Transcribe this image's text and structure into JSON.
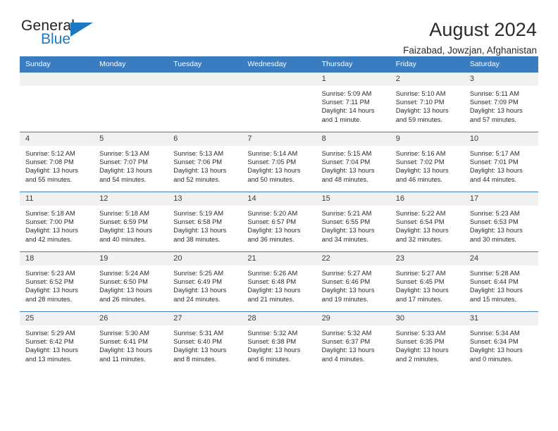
{
  "brand": {
    "name_part1": "General",
    "name_part2": "Blue",
    "triangle_color": "#1d78c1",
    "blue_text_color": "#1d78c1"
  },
  "header": {
    "title": "August 2024",
    "subtitle": "Faizabad, Jowzjan, Afghanistan"
  },
  "theme": {
    "header_row_bg": "#3a7cc0",
    "day_band_bg": "#f1f1f1",
    "grid_line": "#3a7cc0",
    "text": "#2b2b2b"
  },
  "weekday_headers": [
    "Sunday",
    "Monday",
    "Tuesday",
    "Wednesday",
    "Thursday",
    "Friday",
    "Saturday"
  ],
  "labels": {
    "sunrise_prefix": "Sunrise:",
    "sunset_prefix": "Sunset:",
    "daylight_prefix": "Daylight:"
  },
  "weeks": [
    [
      {
        "day": "",
        "empty": true
      },
      {
        "day": "",
        "empty": true
      },
      {
        "day": "",
        "empty": true
      },
      {
        "day": "",
        "empty": true
      },
      {
        "day": "1",
        "sunrise": "Sunrise: 5:09 AM",
        "sunset": "Sunset: 7:11 PM",
        "daylight_line1": "Daylight: 14 hours",
        "daylight_line2": "and 1 minute."
      },
      {
        "day": "2",
        "sunrise": "Sunrise: 5:10 AM",
        "sunset": "Sunset: 7:10 PM",
        "daylight_line1": "Daylight: 13 hours",
        "daylight_line2": "and 59 minutes."
      },
      {
        "day": "3",
        "sunrise": "Sunrise: 5:11 AM",
        "sunset": "Sunset: 7:09 PM",
        "daylight_line1": "Daylight: 13 hours",
        "daylight_line2": "and 57 minutes."
      }
    ],
    [
      {
        "day": "4",
        "sunrise": "Sunrise: 5:12 AM",
        "sunset": "Sunset: 7:08 PM",
        "daylight_line1": "Daylight: 13 hours",
        "daylight_line2": "and 55 minutes."
      },
      {
        "day": "5",
        "sunrise": "Sunrise: 5:13 AM",
        "sunset": "Sunset: 7:07 PM",
        "daylight_line1": "Daylight: 13 hours",
        "daylight_line2": "and 54 minutes."
      },
      {
        "day": "6",
        "sunrise": "Sunrise: 5:13 AM",
        "sunset": "Sunset: 7:06 PM",
        "daylight_line1": "Daylight: 13 hours",
        "daylight_line2": "and 52 minutes."
      },
      {
        "day": "7",
        "sunrise": "Sunrise: 5:14 AM",
        "sunset": "Sunset: 7:05 PM",
        "daylight_line1": "Daylight: 13 hours",
        "daylight_line2": "and 50 minutes."
      },
      {
        "day": "8",
        "sunrise": "Sunrise: 5:15 AM",
        "sunset": "Sunset: 7:04 PM",
        "daylight_line1": "Daylight: 13 hours",
        "daylight_line2": "and 48 minutes."
      },
      {
        "day": "9",
        "sunrise": "Sunrise: 5:16 AM",
        "sunset": "Sunset: 7:02 PM",
        "daylight_line1": "Daylight: 13 hours",
        "daylight_line2": "and 46 minutes."
      },
      {
        "day": "10",
        "sunrise": "Sunrise: 5:17 AM",
        "sunset": "Sunset: 7:01 PM",
        "daylight_line1": "Daylight: 13 hours",
        "daylight_line2": "and 44 minutes."
      }
    ],
    [
      {
        "day": "11",
        "sunrise": "Sunrise: 5:18 AM",
        "sunset": "Sunset: 7:00 PM",
        "daylight_line1": "Daylight: 13 hours",
        "daylight_line2": "and 42 minutes."
      },
      {
        "day": "12",
        "sunrise": "Sunrise: 5:18 AM",
        "sunset": "Sunset: 6:59 PM",
        "daylight_line1": "Daylight: 13 hours",
        "daylight_line2": "and 40 minutes."
      },
      {
        "day": "13",
        "sunrise": "Sunrise: 5:19 AM",
        "sunset": "Sunset: 6:58 PM",
        "daylight_line1": "Daylight: 13 hours",
        "daylight_line2": "and 38 minutes."
      },
      {
        "day": "14",
        "sunrise": "Sunrise: 5:20 AM",
        "sunset": "Sunset: 6:57 PM",
        "daylight_line1": "Daylight: 13 hours",
        "daylight_line2": "and 36 minutes."
      },
      {
        "day": "15",
        "sunrise": "Sunrise: 5:21 AM",
        "sunset": "Sunset: 6:55 PM",
        "daylight_line1": "Daylight: 13 hours",
        "daylight_line2": "and 34 minutes."
      },
      {
        "day": "16",
        "sunrise": "Sunrise: 5:22 AM",
        "sunset": "Sunset: 6:54 PM",
        "daylight_line1": "Daylight: 13 hours",
        "daylight_line2": "and 32 minutes."
      },
      {
        "day": "17",
        "sunrise": "Sunrise: 5:23 AM",
        "sunset": "Sunset: 6:53 PM",
        "daylight_line1": "Daylight: 13 hours",
        "daylight_line2": "and 30 minutes."
      }
    ],
    [
      {
        "day": "18",
        "sunrise": "Sunrise: 5:23 AM",
        "sunset": "Sunset: 6:52 PM",
        "daylight_line1": "Daylight: 13 hours",
        "daylight_line2": "and 28 minutes."
      },
      {
        "day": "19",
        "sunrise": "Sunrise: 5:24 AM",
        "sunset": "Sunset: 6:50 PM",
        "daylight_line1": "Daylight: 13 hours",
        "daylight_line2": "and 26 minutes."
      },
      {
        "day": "20",
        "sunrise": "Sunrise: 5:25 AM",
        "sunset": "Sunset: 6:49 PM",
        "daylight_line1": "Daylight: 13 hours",
        "daylight_line2": "and 24 minutes."
      },
      {
        "day": "21",
        "sunrise": "Sunrise: 5:26 AM",
        "sunset": "Sunset: 6:48 PM",
        "daylight_line1": "Daylight: 13 hours",
        "daylight_line2": "and 21 minutes."
      },
      {
        "day": "22",
        "sunrise": "Sunrise: 5:27 AM",
        "sunset": "Sunset: 6:46 PM",
        "daylight_line1": "Daylight: 13 hours",
        "daylight_line2": "and 19 minutes."
      },
      {
        "day": "23",
        "sunrise": "Sunrise: 5:27 AM",
        "sunset": "Sunset: 6:45 PM",
        "daylight_line1": "Daylight: 13 hours",
        "daylight_line2": "and 17 minutes."
      },
      {
        "day": "24",
        "sunrise": "Sunrise: 5:28 AM",
        "sunset": "Sunset: 6:44 PM",
        "daylight_line1": "Daylight: 13 hours",
        "daylight_line2": "and 15 minutes."
      }
    ],
    [
      {
        "day": "25",
        "sunrise": "Sunrise: 5:29 AM",
        "sunset": "Sunset: 6:42 PM",
        "daylight_line1": "Daylight: 13 hours",
        "daylight_line2": "and 13 minutes."
      },
      {
        "day": "26",
        "sunrise": "Sunrise: 5:30 AM",
        "sunset": "Sunset: 6:41 PM",
        "daylight_line1": "Daylight: 13 hours",
        "daylight_line2": "and 11 minutes."
      },
      {
        "day": "27",
        "sunrise": "Sunrise: 5:31 AM",
        "sunset": "Sunset: 6:40 PM",
        "daylight_line1": "Daylight: 13 hours",
        "daylight_line2": "and 8 minutes."
      },
      {
        "day": "28",
        "sunrise": "Sunrise: 5:32 AM",
        "sunset": "Sunset: 6:38 PM",
        "daylight_line1": "Daylight: 13 hours",
        "daylight_line2": "and 6 minutes."
      },
      {
        "day": "29",
        "sunrise": "Sunrise: 5:32 AM",
        "sunset": "Sunset: 6:37 PM",
        "daylight_line1": "Daylight: 13 hours",
        "daylight_line2": "and 4 minutes."
      },
      {
        "day": "30",
        "sunrise": "Sunrise: 5:33 AM",
        "sunset": "Sunset: 6:35 PM",
        "daylight_line1": "Daylight: 13 hours",
        "daylight_line2": "and 2 minutes."
      },
      {
        "day": "31",
        "sunrise": "Sunrise: 5:34 AM",
        "sunset": "Sunset: 6:34 PM",
        "daylight_line1": "Daylight: 13 hours",
        "daylight_line2": "and 0 minutes."
      }
    ]
  ]
}
